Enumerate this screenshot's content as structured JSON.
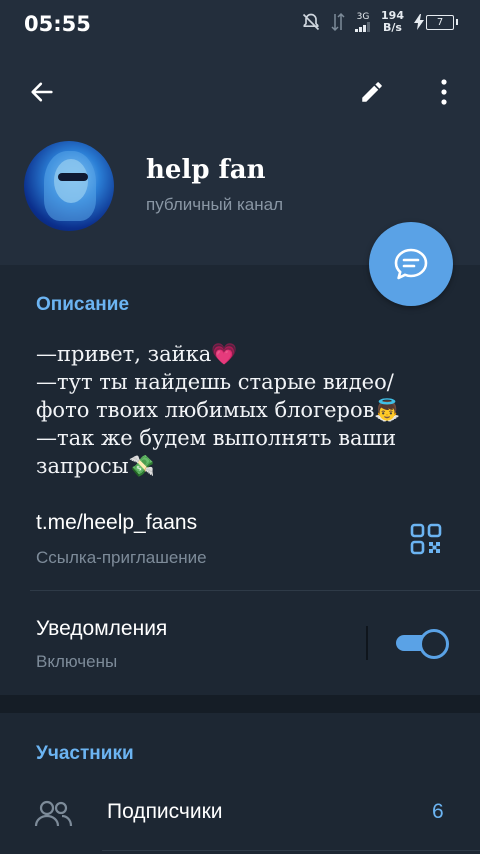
{
  "status_bar": {
    "time": "05:55",
    "network_type": "3G",
    "net_speed_value": "194",
    "net_speed_unit": "B/s",
    "battery_level": "7"
  },
  "header": {
    "channel_name": "help fan",
    "channel_type": "публичный канал"
  },
  "description": {
    "title": "Описание",
    "lines": [
      "—привет, зайка💗",
      "—тут ты найдешь старые видео/",
      "фото твоих любимых блогеров👼",
      "—так же будем выполнять ваши",
      "запросы💸"
    ]
  },
  "invite_link": {
    "url": "t.me/heelp_faans",
    "label": "Ссылка-приглашение"
  },
  "notifications": {
    "label": "Уведомления",
    "state": "Включены",
    "enabled": true
  },
  "members": {
    "title": "Участники",
    "subscribers_label": "Подписчики",
    "subscribers_count": "6"
  },
  "colors": {
    "accent": "#5aa2e6",
    "header_bg": "#232e3c",
    "body_bg": "#1d2733",
    "link_blue": "#6cb4f2"
  },
  "icons": {
    "back": "arrow-left-icon",
    "edit": "pencil-icon",
    "more": "more-vertical-icon",
    "fab": "chat-bubble-icon",
    "qr": "qr-code-icon",
    "subscribers": "people-icon"
  }
}
